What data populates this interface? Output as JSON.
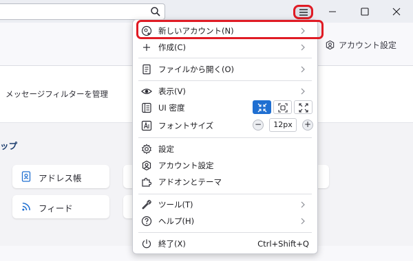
{
  "toolbar": {
    "account_settings": "アカウント設定"
  },
  "content": {
    "filter_link": "メッセージフィルターを管理",
    "section_label": "ップ",
    "tiles": [
      {
        "label": "アドレス帳",
        "icon": "address-book-icon"
      },
      {
        "label": "フィード",
        "icon": "rss-feed-icon"
      }
    ]
  },
  "menu": {
    "items": [
      {
        "label": "新しいアカウント(N)",
        "icon": "new-account-icon",
        "submenu": true,
        "highlighted": true
      },
      {
        "label": "作成(C)",
        "icon": "plus-icon",
        "submenu": true
      },
      {
        "label": "ファイルから開く(O)",
        "icon": "open-file-icon",
        "submenu": true
      },
      {
        "label": "表示(V)",
        "icon": "eye-icon",
        "submenu": true
      },
      {
        "label": "UI 密度",
        "icon": "density-icon"
      },
      {
        "label": "フォントサイズ",
        "icon": "font-size-icon",
        "value": "12px",
        "decrease": "−",
        "increase": "+"
      },
      {
        "label": "設定",
        "icon": "gear-icon"
      },
      {
        "label": "アカウント設定",
        "icon": "account-settings-icon"
      },
      {
        "label": "アドオンとテーマ",
        "icon": "puzzle-icon"
      },
      {
        "label": "ツール(T)",
        "icon": "wrench-icon",
        "submenu": true
      },
      {
        "label": "ヘルプ(H)",
        "icon": "help-icon",
        "submenu": true
      },
      {
        "label": "終了(X)",
        "icon": "power-icon",
        "shortcut": "Ctrl+Shift+Q"
      }
    ],
    "density_selected": "compact"
  },
  "colors": {
    "highlight_border": "#e01b24",
    "accent": "#1f6fd1"
  }
}
